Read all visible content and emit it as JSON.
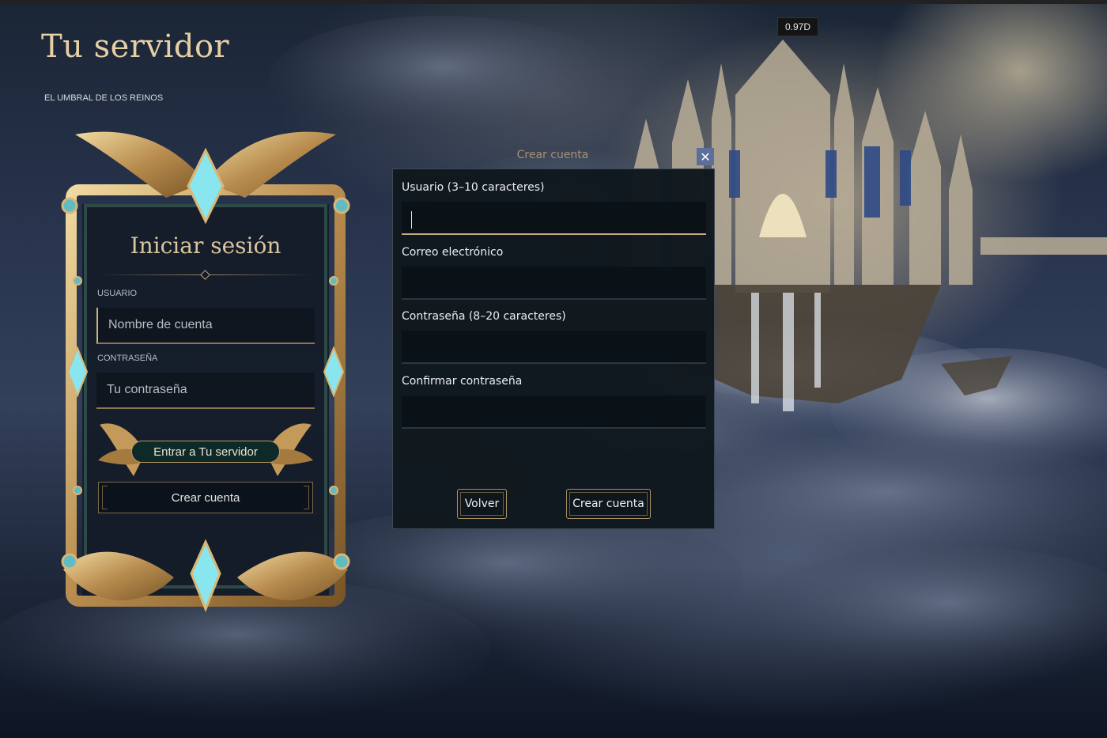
{
  "header": {
    "title": "Tu servidor",
    "subtitle": "EL UMBRAL DE LOS REINOS",
    "version": "0.97D"
  },
  "login": {
    "title": "Iniciar sesión",
    "username_label": "USUARIO",
    "username_placeholder": "Nombre de cuenta",
    "password_label": "CONTRASEÑA",
    "password_placeholder": "Tu contraseña",
    "enter_button": "Entrar a Tu servidor",
    "create_button": "Crear cuenta"
  },
  "modal": {
    "caption": "Crear cuenta",
    "close_symbol": "✕",
    "fields": [
      {
        "label": "Usuario (3–10 caracteres)",
        "value": ""
      },
      {
        "label": "Correo electrónico",
        "value": ""
      },
      {
        "label": "Contraseña (8–20 caracteres)",
        "value": ""
      },
      {
        "label": "Confirmar contraseña",
        "value": ""
      }
    ],
    "back_button": "Volver",
    "submit_button": "Crear cuenta"
  },
  "colors": {
    "gold": "#c9a46a",
    "gem": "#7fe0e8",
    "modal_bg": "#10181f",
    "close_bg": "#5b6f99"
  }
}
